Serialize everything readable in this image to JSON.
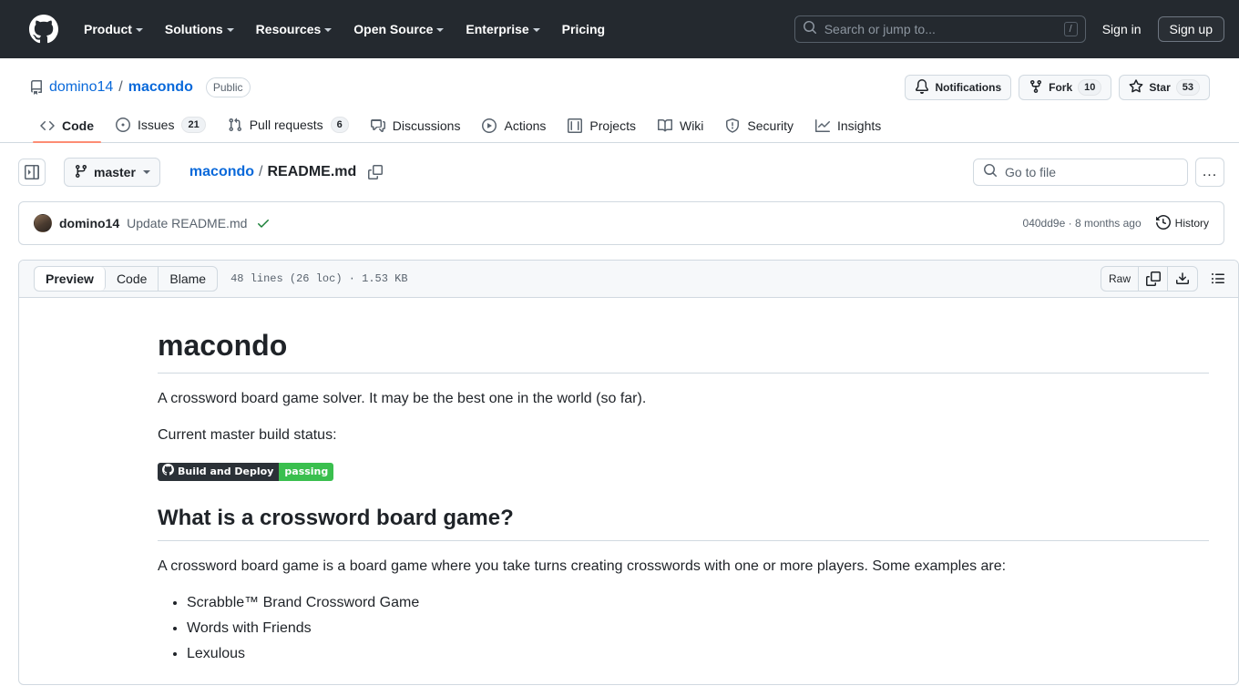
{
  "global_header": {
    "logo_icon": "github-logo-icon",
    "nav": [
      {
        "label": "Product",
        "has_caret": true
      },
      {
        "label": "Solutions",
        "has_caret": true
      },
      {
        "label": "Resources",
        "has_caret": true
      },
      {
        "label": "Open Source",
        "has_caret": true
      },
      {
        "label": "Enterprise",
        "has_caret": true
      },
      {
        "label": "Pricing",
        "has_caret": false
      }
    ],
    "search": {
      "placeholder": "Search or jump to...",
      "icon": "search-icon",
      "shortcut": "/"
    },
    "sign_in": "Sign in",
    "sign_up": "Sign up",
    "background": "#24292f"
  },
  "repo": {
    "icon": "repo-icon",
    "owner": "domino14",
    "separator": "/",
    "name": "macondo",
    "visibility": "Public",
    "actions": [
      {
        "label": "Notifications",
        "icon": "bell-icon",
        "count": null
      },
      {
        "label": "Fork",
        "icon": "fork-icon",
        "count": "10"
      },
      {
        "label": "Star",
        "icon": "star-icon",
        "count": "53"
      }
    ],
    "tabs": [
      {
        "label": "Code",
        "icon": "code-icon",
        "count": null,
        "active": true
      },
      {
        "label": "Issues",
        "icon": "issue-opened-icon",
        "count": "21",
        "active": false
      },
      {
        "label": "Pull requests",
        "icon": "git-pull-request-icon",
        "count": "6",
        "active": false
      },
      {
        "label": "Discussions",
        "icon": "comment-discussion-icon",
        "count": null,
        "active": false
      },
      {
        "label": "Actions",
        "icon": "play-icon",
        "count": null,
        "active": false
      },
      {
        "label": "Projects",
        "icon": "table-icon",
        "count": null,
        "active": false
      },
      {
        "label": "Wiki",
        "icon": "book-icon",
        "count": null,
        "active": false
      },
      {
        "label": "Security",
        "icon": "shield-icon",
        "count": null,
        "active": false
      },
      {
        "label": "Insights",
        "icon": "graph-icon",
        "count": null,
        "active": false
      }
    ],
    "active_tab_underline_color": "#fd8c73"
  },
  "file_nav": {
    "sidebar_toggle_icon": "sidebar-expand-icon",
    "branch": "master",
    "branch_icon": "git-branch-icon",
    "breadcrumb": {
      "repo": "macondo",
      "separator": "/",
      "file": "README.md"
    },
    "copy_path_icon": "copy-icon",
    "go_to_file": {
      "placeholder": "Go to file",
      "icon": "search-icon"
    },
    "more_options": "..."
  },
  "commit": {
    "avatar": "avatar",
    "author": "domino14",
    "message": "Update README.md",
    "status_icon": "check-icon",
    "sha": "040dd9e",
    "sha_separator": "·",
    "relative_time": "8 months ago",
    "history_label": "History",
    "history_icon": "history-icon"
  },
  "file_view": {
    "view_tabs": [
      {
        "label": "Preview",
        "active": true
      },
      {
        "label": "Code",
        "active": false
      },
      {
        "label": "Blame",
        "active": false
      }
    ],
    "meta": "48 lines (26 loc) · 1.53 KB",
    "raw_label": "Raw",
    "copy_icon": "copy-raw-icon",
    "download_icon": "download-icon",
    "outline_icon": "table-of-contents-icon"
  },
  "readme": {
    "h1": "macondo",
    "intro": "A crossword board game solver. It may be the best one in the world (so far).",
    "build_status_label": "Current master build status:",
    "badge": {
      "icon": "github-mark-icon",
      "left_text": "Build and Deploy",
      "right_text": "passing",
      "left_color": "#2b3137",
      "right_color": "#3abf4e"
    },
    "h2": "What is a crossword board game?",
    "paragraph": "A crossword board game is a board game where you take turns creating crosswords with one or more players. Some examples are:",
    "list": [
      "Scrabble™ Brand Crossword Game",
      "Words with Friends",
      "Lexulous"
    ]
  }
}
